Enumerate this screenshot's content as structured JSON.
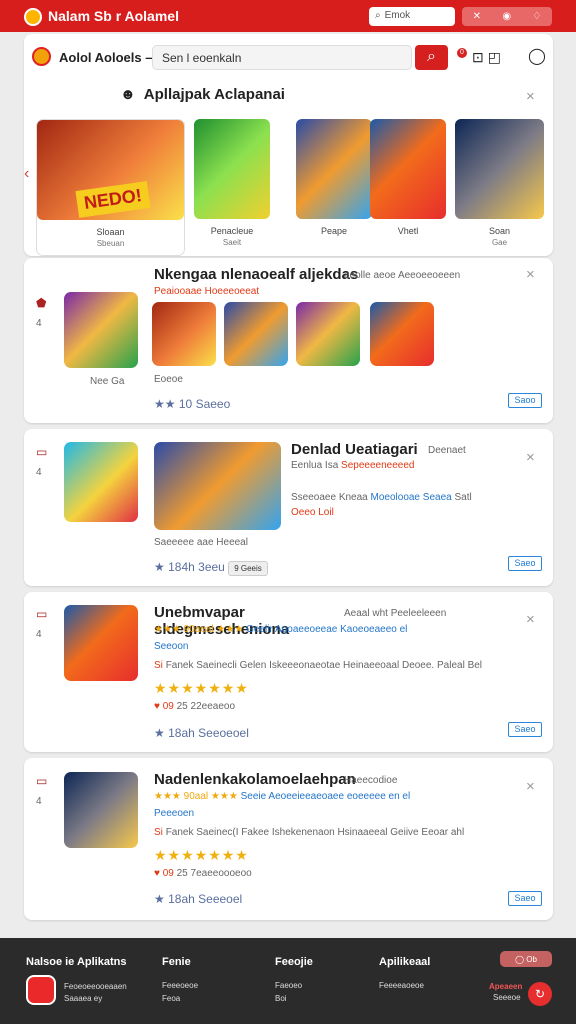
{
  "header": {
    "title": "Nalam Sb r Aolamel",
    "search_placeholder": "Emok",
    "actions": [
      "✕",
      "◉",
      "♢"
    ]
  },
  "toolbar": {
    "app_name": "Aolol Aoloels –",
    "search_value": "Sen l eoenkaln",
    "search_icon": "search-icon",
    "notification_count": "0",
    "icons": [
      "mail-icon",
      "camera-icon"
    ],
    "user_icon": "user-icon"
  },
  "featured": {
    "title": "Apllajpak Aclapanai",
    "cards": [
      {
        "label": "Sloaan",
        "sub": "Sbeuan"
      },
      {
        "label": "Penacleue",
        "sub": "Saeit"
      },
      {
        "label": "Peape",
        "sub": ""
      },
      {
        "label": "Vhetl",
        "sub": ""
      },
      {
        "label": "Soan",
        "sub": "Gae"
      }
    ]
  },
  "section2": {
    "title": "Nkengaa nlenaoealf aljekdas",
    "subtitle": "Peaiooaae Hoeeeoeeat",
    "extra": "aeolle aeoe Aeeoeeoeeen",
    "app_label": "Nee Ga",
    "subicon": "Eoeoe",
    "rating": "10",
    "reviews": "Saeeo",
    "cta": "Saoo"
  },
  "section3": {
    "title": "Denlad Ueatiagari",
    "subtitle": "Deenaet",
    "meta": "Eenlua Isa",
    "meta_accent": "Sepeeeeneeeed",
    "desc": "Sseeoaee Kneaa",
    "desc_accent": "Moeolooae Seaea",
    "desc_tail": "Satl",
    "emphasis": "Oeeo Loil",
    "footer_text": "Saeeeee aae Heeeal",
    "rating": "184h",
    "reviews": "3eeu",
    "tag": "9 Geeis",
    "cta": "Saeo"
  },
  "section4": {
    "title": "Unebmvapar sldegmeseheniona",
    "title_meta": "Aeaal wht Peeleeleeen",
    "rating_text": "★★★ 90aeal ★★★",
    "review": "Geelir Agoaeeoeeae Kaoeoeaeeo el",
    "author": "Seeoon",
    "desc_prefix": "Si",
    "desc": "Fanek Saeinecli Gelen Iskeeeonaeotae Heinaeeoaal Deoee. Paleal Bel",
    "stars": "★★★★★★★",
    "hearts": "♥ 09",
    "date": "25 22eeaeoo",
    "likes": "18ah",
    "likes_text": "Seeoeoel",
    "cta": "Saeo"
  },
  "section5": {
    "title": "Nadenlenkakolamoelaehpan",
    "title_meta": "Haeecodioe",
    "rating_text": "★★★ 90aal ★★★",
    "review": "Seeie Aeoeeieeaeoaee eoeeeee en el",
    "author": "Peeeoen",
    "desc_prefix": "Si",
    "desc": "Fanek Saeinec(I Fakee Ishekenenaon Hsinaaeeal Geiive Eeoar ahl",
    "stars": "★★★★★★★",
    "hearts": "♥ 09",
    "date": "25 7eaeeoooeoo",
    "likes": "18ah",
    "likes_text": "Seeeoel",
    "cta": "Saeo"
  },
  "footer": {
    "title": "Nalsoe ie Aplikatns",
    "links": [
      {
        "title": "Fenie",
        "items": [
          "Feeeoeoe",
          "Feoa"
        ]
      },
      {
        "title": "Feeojie",
        "items": [
          "Faeoeo",
          "Boi"
        ]
      },
      {
        "title": "Apilikeaal",
        "items": [
          "Feeeeaoeoe"
        ]
      }
    ],
    "info": [
      "Feoeoeeooeaaen",
      "Saaaea ey"
    ],
    "lang": "◯ Ob",
    "store": "Apeaeen",
    "store_sub": "Seeeoe"
  }
}
